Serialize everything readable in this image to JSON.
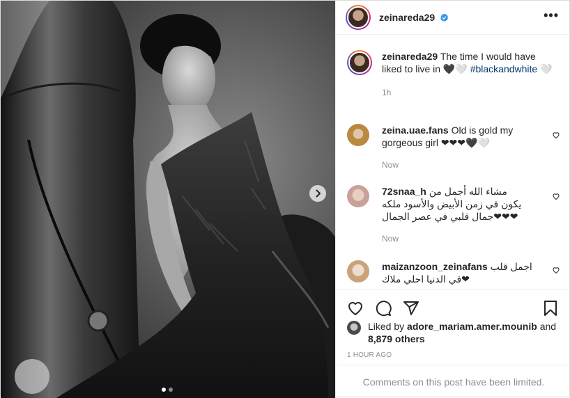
{
  "post": {
    "username": "zeinareda29",
    "verified": true,
    "more_icon": "more-horizontal-icon",
    "carousel": {
      "current": 1,
      "total": 2
    }
  },
  "caption": {
    "username": "zeinareda29",
    "text": "The time I would have liked to live in 🖤🤍",
    "hashtag": "#blackandwhite",
    "emoji": "🤍",
    "time": "1h"
  },
  "comments": [
    {
      "username": "zeina.uae.fans",
      "text": "Old is gold my gorgeous girl ❤❤❤🖤🤍",
      "time": "Now",
      "rtl": false
    },
    {
      "username": "72snaa_h",
      "text": "مشاء الله أجمل من يكون في زمن الأبيض والأسود ملكه جمال قلبي في عصر الجمال❤❤❤",
      "time": "Now",
      "rtl": true
    },
    {
      "username": "maizanzoon_zeinafans",
      "text": "اجمل قلب في الدنيا احلي ملاك❤",
      "time": "",
      "rtl": true
    }
  ],
  "actions": {
    "like_icon": "heart-icon",
    "comment_icon": "comment-icon",
    "share_icon": "share-icon",
    "save_icon": "bookmark-icon"
  },
  "likes": {
    "prefix": "Liked by",
    "user": "adore_mariam.amer.mounib",
    "and": "and",
    "others": "8,879 others"
  },
  "post_time": "1 HOUR AGO",
  "comments_limited": "Comments on this post have been limited.",
  "colors": {
    "verified": "#3897f0",
    "link": "#00376b",
    "muted": "#8e8e8e"
  }
}
